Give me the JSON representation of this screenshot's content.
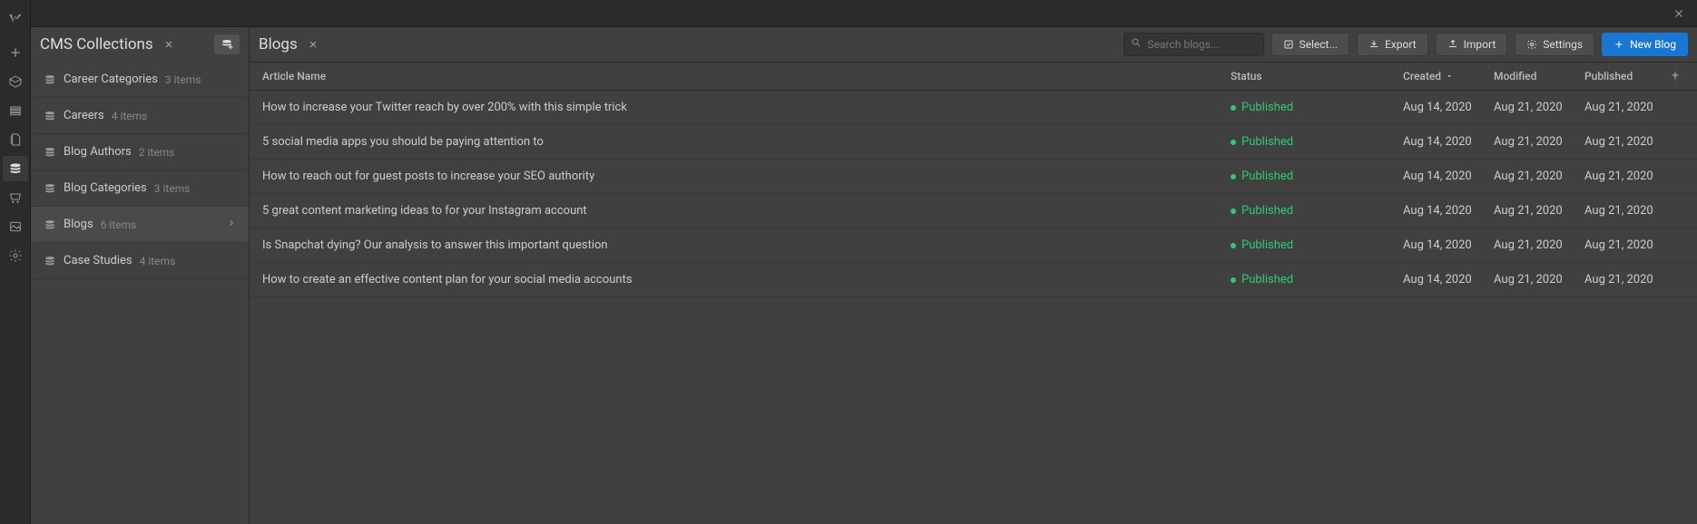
{
  "panel": {
    "title": "CMS Collections",
    "collections": [
      {
        "name": "Career Categories",
        "count": "3 items"
      },
      {
        "name": "Careers",
        "count": "4 items"
      },
      {
        "name": "Blog Authors",
        "count": "2 items"
      },
      {
        "name": "Blog Categories",
        "count": "3 items"
      },
      {
        "name": "Blogs",
        "count": "6 items"
      },
      {
        "name": "Case Studies",
        "count": "4 items"
      }
    ]
  },
  "detail": {
    "title": "Blogs",
    "search_placeholder": "Search blogs...",
    "buttons": {
      "select": "Select...",
      "export": "Export",
      "import": "Import",
      "settings": "Settings",
      "new": "New Blog"
    },
    "columns": {
      "name": "Article Name",
      "status": "Status",
      "created": "Created",
      "modified": "Modified",
      "published": "Published"
    },
    "rows": [
      {
        "name": "How to increase your Twitter reach by over 200% with this simple trick",
        "status": "Published",
        "created": "Aug 14, 2020",
        "modified": "Aug 21, 2020",
        "published": "Aug 21, 2020"
      },
      {
        "name": "5 social media apps you should be paying attention to",
        "status": "Published",
        "created": "Aug 14, 2020",
        "modified": "Aug 21, 2020",
        "published": "Aug 21, 2020"
      },
      {
        "name": "How to reach out for guest posts to increase your SEO authority",
        "status": "Published",
        "created": "Aug 14, 2020",
        "modified": "Aug 21, 2020",
        "published": "Aug 21, 2020"
      },
      {
        "name": "5 great content marketing ideas to for your Instagram account",
        "status": "Published",
        "created": "Aug 14, 2020",
        "modified": "Aug 21, 2020",
        "published": "Aug 21, 2020"
      },
      {
        "name": "Is Snapchat dying? Our analysis to answer this important question",
        "status": "Published",
        "created": "Aug 14, 2020",
        "modified": "Aug 21, 2020",
        "published": "Aug 21, 2020"
      },
      {
        "name": "How to create an effective content plan for your social media accounts",
        "status": "Published",
        "created": "Aug 14, 2020",
        "modified": "Aug 21, 2020",
        "published": "Aug 21, 2020"
      }
    ]
  }
}
